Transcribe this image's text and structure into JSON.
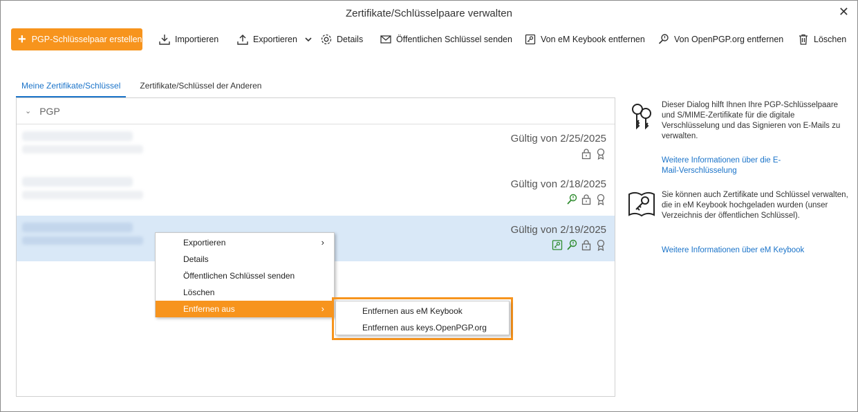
{
  "window": {
    "title": "Zertifikate/Schlüsselpaare verwalten",
    "close_glyph": "✕"
  },
  "toolbar": {
    "create_label": "PGP-Schlüsselpaar erstellen",
    "import_label": "Importieren",
    "export_label": "Exportieren",
    "details_label": "Details",
    "send_key_label": "Öffentlichen Schlüssel senden",
    "remove_keybook_label": "Von eM Keybook entfernen",
    "remove_openpgp_label": "Von OpenPGP.org entfernen",
    "delete_label": "Löschen"
  },
  "tabs": [
    {
      "label": "Meine Zertifikate/Schlüssel",
      "active": true
    },
    {
      "label": "Zertifikate/Schlüssel der Anderen",
      "active": false
    }
  ],
  "list": {
    "group_label": "PGP",
    "rows": [
      {
        "validity": "Gültig von 2/25/2025",
        "icons": [
          "lock-icon",
          "certificate-icon"
        ]
      },
      {
        "validity": "Gültig von 2/18/2025",
        "icons": [
          "openpgp-key-icon",
          "lock-icon",
          "certificate-icon"
        ]
      },
      {
        "validity": "Gültig von 2/19/2025",
        "icons": [
          "keybook-icon",
          "openpgp-key-icon",
          "lock-icon",
          "certificate-icon"
        ],
        "selected": true
      }
    ]
  },
  "context_menu": {
    "items": [
      {
        "label": "Exportieren",
        "has_submenu": true
      },
      {
        "label": "Details"
      },
      {
        "label": "Öffentlichen Schlüssel senden"
      },
      {
        "label": "Löschen"
      },
      {
        "label": "Entfernen aus",
        "has_submenu": true,
        "highlighted": true
      }
    ],
    "submenu_arrow": "›"
  },
  "submenu": {
    "items": [
      {
        "label": "Entfernen aus eM Keybook"
      },
      {
        "label": "Entfernen aus keys.OpenPGP.org"
      }
    ]
  },
  "info": {
    "text1": "Dieser Dialog hilft Ihnen Ihre PGP-Schlüsselpaare und S/MIME-Zertifikate für die digitale Verschlüsselung und das Signieren von E-Mails zu verwalten.",
    "link1": "Weitere Informationen über die E-Mail-Verschlüsselung",
    "text2": "Sie können auch Zertifikate und Schlüssel verwalten, die in eM Keybook hochgeladen wurden (unser Verzeichnis der öffentlichen Schlüssel).",
    "link2": "Weitere Informationen über eM Keybook"
  },
  "colors": {
    "accent": "#f7941d",
    "link": "#1a73c9",
    "selection": "#d9e8f7",
    "green_icon": "#2e8b2e"
  }
}
